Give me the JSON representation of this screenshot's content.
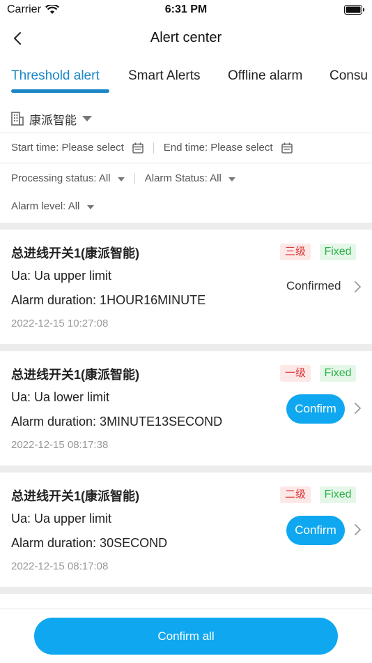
{
  "status_bar": {
    "carrier": "Carrier",
    "time": "6:31 PM"
  },
  "nav": {
    "title": "Alert center"
  },
  "tabs": [
    {
      "label": "Threshold alert",
      "active": true
    },
    {
      "label": "Smart Alerts",
      "active": false
    },
    {
      "label": "Offline alarm",
      "active": false
    },
    {
      "label": "Consu",
      "active": false
    }
  ],
  "org": {
    "name": "康派智能"
  },
  "filters": {
    "start_time_label": "Start time:",
    "start_time_value": "Please select",
    "end_time_label": "End time:",
    "end_time_value": "Please select",
    "processing_status_label": "Processing status:",
    "processing_status_value": "All",
    "alarm_status_label": "Alarm Status:",
    "alarm_status_value": "All",
    "alarm_level_label": "Alarm level:",
    "alarm_level_value": "All"
  },
  "alerts": [
    {
      "name": "总进线开关1(康派智能)",
      "level": "三级",
      "status": "Fixed",
      "description": "Ua: Ua upper limit",
      "duration": "Alarm duration: 1HOUR16MINUTE",
      "timestamp": "2022-12-15 10:27:08",
      "action": "Confirmed"
    },
    {
      "name": "总进线开关1(康派智能)",
      "level": "一级",
      "status": "Fixed",
      "description": "Ua: Ua lower limit",
      "duration": "Alarm duration: 3MINUTE13SECOND",
      "timestamp": "2022-12-15 08:17:38",
      "action": "Confirm"
    },
    {
      "name": "总进线开关1(康派智能)",
      "level": "二级",
      "status": "Fixed",
      "description": "Ua: Ua upper limit",
      "duration": "Alarm duration: 30SECOND",
      "timestamp": "2022-12-15 08:17:08",
      "action": "Confirm"
    }
  ],
  "footer": {
    "confirm_all": "Confirm all"
  },
  "colors": {
    "accent": "#1a86c8",
    "button": "#0fa8f0",
    "level_bg": "#fde8e8",
    "level_text": "#e03434",
    "fixed_bg": "#e5f7e8",
    "fixed_text": "#29b34a"
  },
  "icons": [
    "wifi-icon",
    "battery-icon",
    "back-arrow-icon",
    "building-icon",
    "calendar-icon",
    "chevron-right-icon"
  ]
}
